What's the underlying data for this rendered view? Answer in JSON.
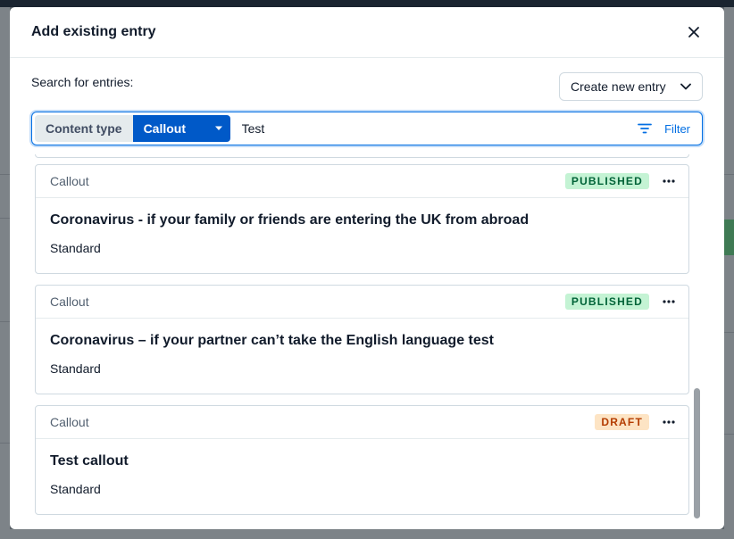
{
  "modal": {
    "title": "Add existing entry",
    "search_label": "Search for entries:",
    "create_button": "Create new entry"
  },
  "search": {
    "content_type_label": "Content type",
    "selected_type": "Callout",
    "query": "Test",
    "filter_label": "Filter"
  },
  "entries": [
    {
      "type": "Callout",
      "status": "PUBLISHED",
      "status_color": "#c4f3d4",
      "title": "Coronavirus - if your family or friends are entering the UK from abroad",
      "subtitle": "Standard"
    },
    {
      "type": "Callout",
      "status": "PUBLISHED",
      "status_color": "#c4f3d4",
      "title": "Coronavirus – if your partner can’t take the English language test",
      "subtitle": "Standard"
    },
    {
      "type": "Callout",
      "status": "DRAFT",
      "status_color": "#fde4c4",
      "title": "Test callout",
      "subtitle": "Standard"
    }
  ],
  "colors": {
    "primary": "#0059c8",
    "focus_border": "#036fe3"
  }
}
